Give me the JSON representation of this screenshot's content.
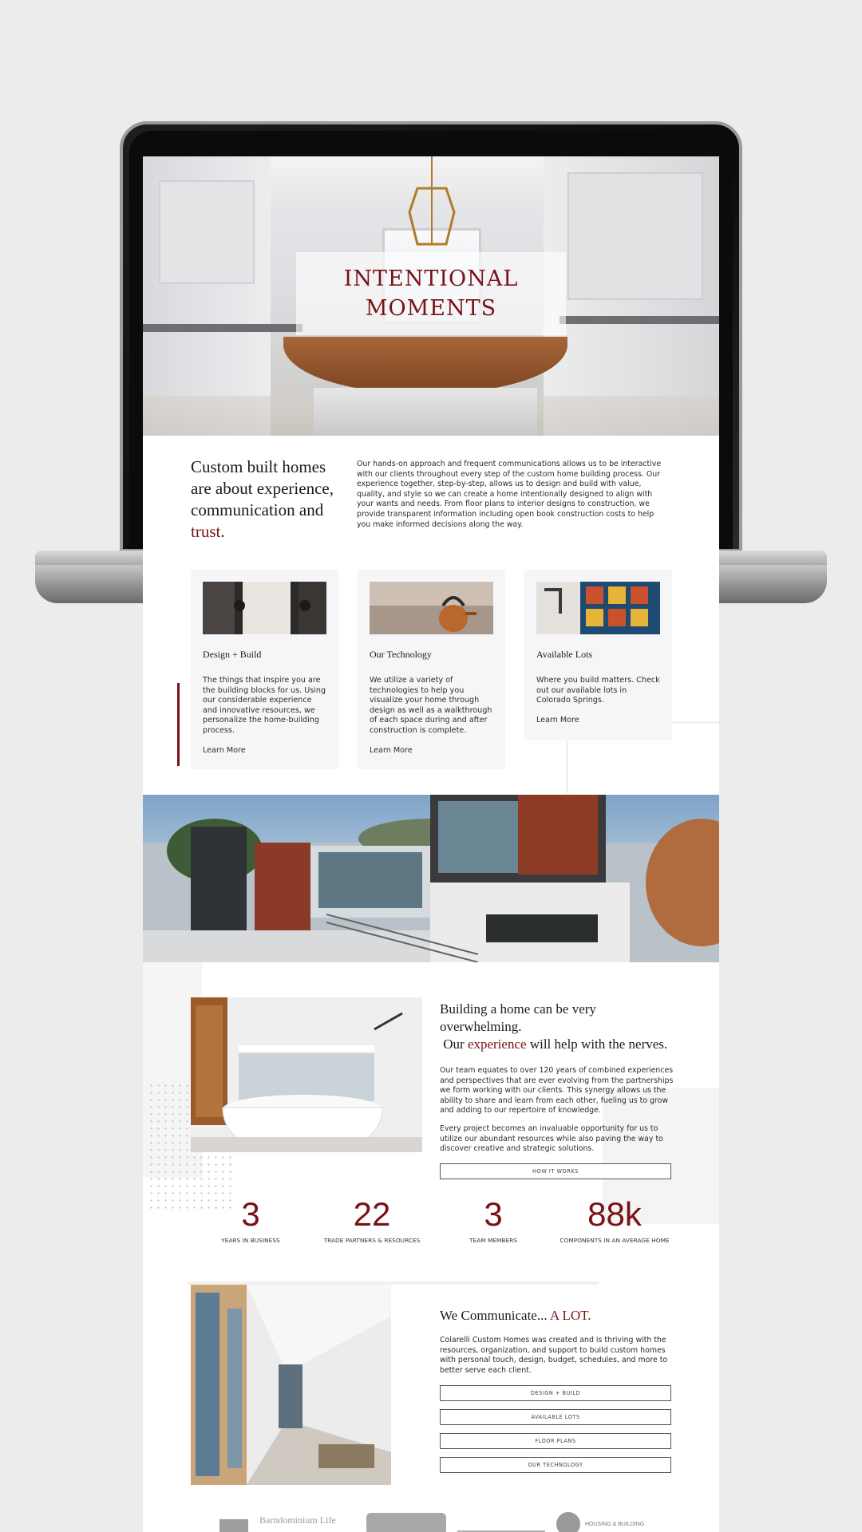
{
  "hero": {
    "title_line1": "INTENTIONAL",
    "title_line2": "MOMENTS"
  },
  "intro": {
    "heading_main": "Custom built homes are about experience, communication and",
    "heading_accent": "trust",
    "heading_end": ".",
    "body": "Our hands-on approach and frequent communications allows us to be interactive with our clients throughout every step of the custom home building process. Our experience together, step-by-step, allows us to design and build with value, quality, and style so we can create a home intentionally designed to align with your wants and needs. From floor plans to interior designs to construction, we provide transparent information including open book construction costs to help you make informed decisions along the way."
  },
  "cards": [
    {
      "title": "Design + Build",
      "body": "The things that inspire you are the building blocks for us. Using our considerable experience and innovative resources, we personalize the home-building process.",
      "link": "Learn More"
    },
    {
      "title": "Our Technology",
      "body": "We utilize a variety of technologies to help you visualize your home through design as well as a walkthrough of each space during and after construction is complete.",
      "link": "Learn More"
    },
    {
      "title": "Available Lots",
      "body": "Where you build matters. Check out our available lots in Colorado Springs.",
      "link": "Learn More"
    }
  ],
  "overwhelm": {
    "heading_line1": "Building a home can be very overwhelming.",
    "heading_pre": "Our",
    "heading_accent": "experience",
    "heading_post": "will help with the nerves.",
    "para1": "Our team equates to over 120 years of combined experiences and perspectives that are ever evolving from the partnerships we form working with our clients. This synergy allows us the ability to share and learn from each other, fueling us to grow and adding to our repertoire of knowledge.",
    "para2": "Every project becomes an invaluable opportunity for us to utilize our abundant resources while also paving the way to discover creative and strategic solutions.",
    "button": "HOW IT WORKS"
  },
  "stats": [
    {
      "num": "3",
      "label": "YEARS IN BUSINESS"
    },
    {
      "num": "22",
      "label": "TRADE PARTNERS & RESOURCES"
    },
    {
      "num": "3",
      "label": "TEAM MEMBERS"
    },
    {
      "num": "88k",
      "label": "COMPONENTS IN AN AVERAGE HOME"
    }
  ],
  "communicate": {
    "heading_pre": "We Communicate...",
    "heading_accent": "A LOT.",
    "body": "Colarelli Custom Homes was created and is thriving with the resources, organization, and support to build custom homes with personal touch, design, budget, schedules, and more to better serve each client.",
    "buttons": [
      "DESIGN + BUILD",
      "AVAILABLE LOTS",
      "FLOOR PLANS",
      "OUR TECHNOLOGY"
    ]
  },
  "logos": {
    "barndominium": "Barndominium Life",
    "housing": "HOUSING & BUILDING"
  },
  "colors": {
    "accent": "#7a1116",
    "card_bg": "#f6f6f8"
  }
}
